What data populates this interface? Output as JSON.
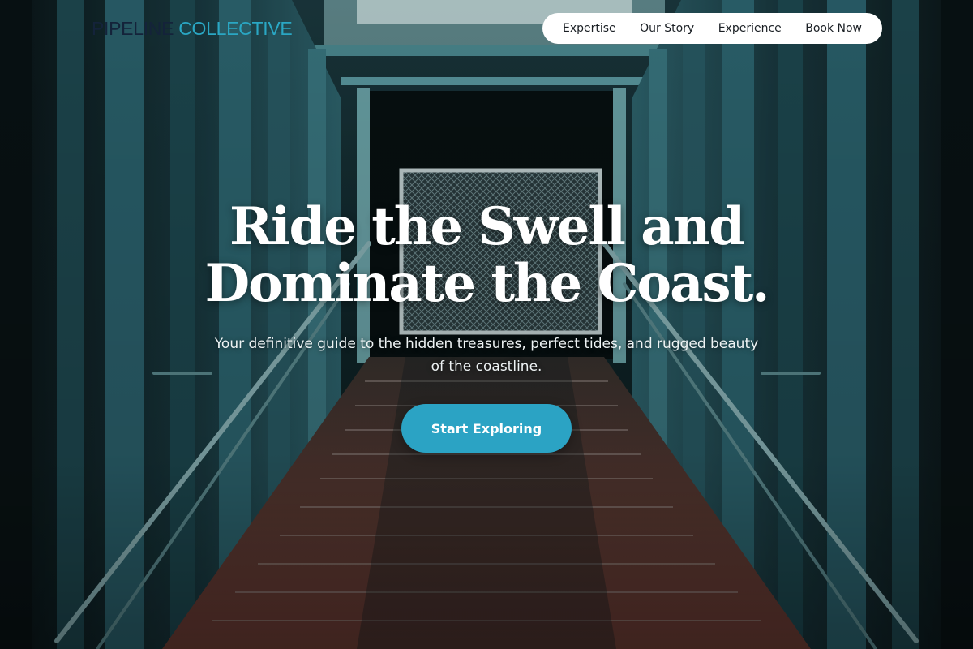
{
  "header": {
    "brand_part1": "PIPELINE",
    "brand_part2": " COLLECTIVE"
  },
  "nav": {
    "items": [
      {
        "label": "Expertise"
      },
      {
        "label": "Our Story"
      },
      {
        "label": "Experience"
      },
      {
        "label": "Book Now"
      }
    ]
  },
  "hero": {
    "headline_line1": "Ride the Swell and",
    "headline_line2": "Dominate the Coast.",
    "subtitle": "Your definitive guide to the hidden treasures, perfect tides, and rugged beauty of the coastline.",
    "cta_label": "Start Exploring",
    "background_image": "stairway-photo"
  },
  "colors": {
    "accent": "#2ba3c4",
    "brand_dark": "#14233a",
    "nav_background": "#ffffff",
    "headline": "#ffffff"
  }
}
